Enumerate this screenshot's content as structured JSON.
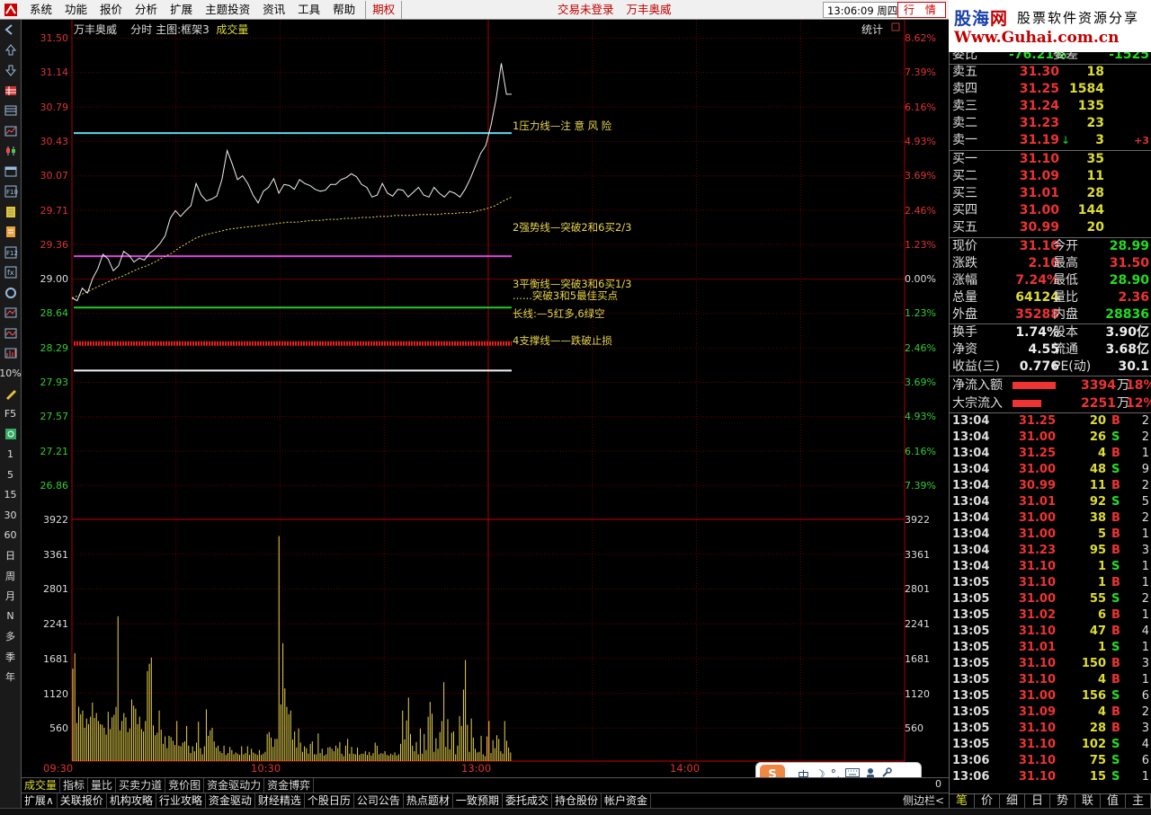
{
  "menu": {
    "items": [
      "系统",
      "功能",
      "报价",
      "分析",
      "扩展",
      "主题投资",
      "资讯",
      "工具",
      "帮助"
    ],
    "futures": "期权",
    "status_text": "交易未登录",
    "stock_name": "万丰奥威",
    "clock": "13:06:09 周四",
    "quote_btn": "行 情"
  },
  "brand": {
    "line1a": "股海",
    "line1b": "网",
    "line2": "股票软件资源分享",
    "line3": "Www.Guhai.com.cn"
  },
  "left_toolbar": {
    "icons": [
      "back-icon",
      "up-icon",
      "down-icon",
      "grid-icon",
      "table-icon",
      "chart-icon",
      "candle-icon",
      "window-icon",
      "f10-icon",
      "book-icon",
      "note-icon",
      "f12-icon",
      "formula-icon",
      "circle-icon",
      "trend-icon",
      "wave-icon",
      "bar-icon"
    ],
    "labels": [
      "10%",
      "F5",
      "1",
      "5",
      "15",
      "30",
      "60",
      "日",
      "周",
      "月",
      "N",
      "多",
      "季",
      "年"
    ]
  },
  "chart": {
    "header": {
      "name": "万丰奥威",
      "mode": "分时 主图:框架3",
      "vol": "成交量"
    },
    "stat_label": "统计",
    "price_labels": [
      "31.50",
      "31.14",
      "30.79",
      "30.43",
      "30.07",
      "29.71",
      "29.36",
      "29.00",
      "28.64",
      "28.29",
      "27.93",
      "27.57",
      "27.21",
      "26.86"
    ],
    "pct_labels": [
      "8.62%",
      "7.39%",
      "6.16%",
      "4.93%",
      "3.69%",
      "2.46%",
      "1.23%",
      "0.00%",
      "1.23%",
      "2.46%",
      "3.69%",
      "4.93%",
      "6.16%",
      "7.39%"
    ],
    "vol_labels": [
      "3922",
      "3361",
      "2801",
      "2241",
      "1681",
      "1120",
      "560"
    ],
    "time_labels": [
      "09:30",
      "10:30",
      "13:00",
      "14:00"
    ],
    "annotations": {
      "resist": "1压力线—注 意 风 险",
      "strong": "2强势线—突破2和6买2/3",
      "balance": "3平衡线—突破3和6买1/3",
      "best": "......突破3和5最佳买点",
      "long": "长线:—5红多,6绿空",
      "support": "4支撑线——跌破止损"
    },
    "levels": {
      "resist": 30.7,
      "strong": 29.43,
      "balance": 28.9,
      "long": 28.53,
      "support": 28.25
    },
    "colors": {
      "resist": "#5bd8ee",
      "strong": "#e040e0",
      "balance": "#22cc22",
      "long": "#e02020",
      "support": "#f4f4f4"
    },
    "price_series": [
      29.0,
      28.97,
      29.1,
      29.05,
      29.2,
      29.3,
      29.45,
      29.4,
      29.28,
      29.33,
      29.48,
      29.44,
      29.37,
      29.41,
      29.39,
      29.46,
      29.5,
      29.56,
      29.64,
      29.82,
      29.9,
      29.84,
      29.9,
      29.95,
      30.18,
      30.06,
      30.0,
      30.02,
      30.05,
      30.22,
      30.52,
      30.38,
      30.22,
      30.26,
      30.18,
      30.06,
      29.98,
      30.1,
      30.14,
      30.23,
      30.08,
      30.17,
      30.16,
      30.12,
      30.22,
      30.18,
      30.16,
      30.12,
      30.1,
      30.11,
      30.17,
      30.17,
      30.22,
      30.24,
      30.28,
      30.25,
      30.17,
      30.14,
      30.04,
      30.06,
      30.18,
      30.08,
      30.05,
      30.12,
      30.11,
      30.04,
      30.09,
      30.14,
      30.06,
      30.04,
      30.14,
      30.08,
      30.04,
      30.1,
      30.08,
      30.04,
      30.12,
      30.23,
      30.36,
      30.49,
      30.57,
      30.78,
      31.05,
      31.42,
      31.1,
      31.1
    ],
    "avg_series": [
      29.0,
      29.03,
      29.07,
      29.11,
      29.15,
      29.19,
      29.22,
      29.26,
      29.3,
      29.33,
      29.37,
      29.42,
      29.46,
      29.52,
      29.57,
      29.62,
      29.65,
      29.67,
      29.69,
      29.71,
      29.72,
      29.73,
      29.74,
      29.75,
      29.76,
      29.77,
      29.78,
      29.78,
      29.79,
      29.8,
      29.8,
      29.81,
      29.81,
      29.82,
      29.82,
      29.83,
      29.83,
      29.84,
      29.84,
      29.85,
      29.85,
      29.85,
      29.86,
      29.86,
      29.86,
      29.87,
      29.87,
      29.88,
      29.88,
      29.9,
      29.92,
      29.95,
      30.0,
      30.04
    ],
    "volume_series": [
      1500,
      1750,
      620,
      880,
      760,
      820,
      540,
      690,
      600,
      720,
      950,
      700,
      780,
      650,
      600,
      590,
      540,
      430,
      800,
      520,
      710,
      750,
      880,
      2350,
      500,
      650,
      780,
      710,
      470,
      530,
      1000,
      900,
      850,
      600,
      720,
      520,
      480,
      650,
      1460,
      1580,
      1680,
      580,
      420,
      460,
      820,
      510,
      280,
      400,
      210,
      410,
      390,
      330,
      260,
      650,
      250,
      240,
      300,
      320,
      570,
      250,
      130,
      240,
      160,
      300,
      640,
      210,
      110,
      240,
      840,
      410,
      500,
      540,
      320,
      220,
      250,
      160,
      130,
      250,
      100,
      130,
      230,
      180,
      110,
      140,
      120,
      100,
      240,
      110,
      130,
      240,
      100,
      200,
      140,
      120,
      100,
      180,
      100,
      120,
      150,
      440,
      470,
      380,
      230,
      360,
      360,
      3650,
      920,
      1910,
      1180,
      880,
      760,
      820,
      350,
      480,
      220,
      530,
      300,
      150,
      240,
      210,
      120,
      280,
      320,
      110,
      110,
      450,
      130,
      200,
      90,
      110,
      220,
      230,
      200,
      160,
      250,
      210,
      310,
      120,
      80,
      250,
      360,
      120,
      230,
      120,
      110,
      220,
      100,
      120,
      120,
      160,
      100,
      150,
      90,
      130,
      300,
      250,
      110,
      130,
      120,
      160,
      100,
      90,
      120,
      100,
      140,
      90,
      110,
      280,
      820,
      350,
      660,
      1030,
      440,
      250,
      160,
      310,
      110,
      530,
      120,
      440,
      180,
      720,
      960,
      770,
      150,
      370,
      200,
      470,
      650,
      1280,
      230,
      680,
      190,
      460,
      480,
      110,
      250,
      730,
      570,
      1160,
      1640,
      590,
      150,
      690,
      380,
      200,
      140,
      150,
      410,
      110,
      80,
      400,
      650,
      130,
      340,
      210,
      420,
      360,
      160,
      120,
      650,
      330,
      220,
      140
    ]
  },
  "tabs1": [
    "成交量",
    "指标",
    "量比",
    "买卖力道",
    "竞价图",
    "资金驱动力",
    "资金博弈"
  ],
  "tabs2": [
    "扩展∧",
    "关联报价",
    "机构攻略",
    "行业攻略",
    "资金驱动",
    "财经精选",
    "个股日历",
    "公司公告",
    "热点题材",
    "一致预期",
    "委托成交",
    "持仓股份",
    "帐户资金"
  ],
  "tabs2_side": "侧边栏<",
  "tabs_num": "0",
  "ime": {
    "logo": "S",
    "text": "中",
    "moon": "☽",
    "deg": "°,"
  },
  "right_panel": {
    "ratio": {
      "label": "委比",
      "value": "-76.21%",
      "diff_label": "委差",
      "diff": "-1525"
    },
    "asks": [
      {
        "label": "卖五",
        "price": "31.30",
        "vol": "18"
      },
      {
        "label": "卖四",
        "price": "31.25",
        "vol": "1584"
      },
      {
        "label": "卖三",
        "price": "31.24",
        "vol": "135"
      },
      {
        "label": "卖二",
        "price": "31.23",
        "vol": "23"
      },
      {
        "label": "卖一",
        "price": "31.19",
        "vol": "3",
        "extra": "+3"
      }
    ],
    "bids": [
      {
        "label": "买一",
        "price": "31.10",
        "vol": "35"
      },
      {
        "label": "买二",
        "price": "31.09",
        "vol": "11"
      },
      {
        "label": "买三",
        "price": "31.01",
        "vol": "28"
      },
      {
        "label": "买四",
        "price": "31.00",
        "vol": "144"
      },
      {
        "label": "买五",
        "price": "30.99",
        "vol": "20"
      }
    ],
    "stats": [
      {
        "l1": "现价",
        "v1": "31.10",
        "c1": "red",
        "l2": "今开",
        "v2": "28.99",
        "c2": "green"
      },
      {
        "l1": "涨跌",
        "v1": "2.10",
        "c1": "red",
        "l2": "最高",
        "v2": "31.50",
        "c2": "red"
      },
      {
        "l1": "涨幅",
        "v1": "7.24%",
        "c1": "red",
        "l2": "最低",
        "v2": "28.90",
        "c2": "green"
      },
      {
        "l1": "总量",
        "v1": "64124",
        "c1": "yellow",
        "l2": "量比",
        "v2": "2.36",
        "c2": "red"
      },
      {
        "l1": "外盘",
        "v1": "35288",
        "c1": "red",
        "l2": "内盘",
        "v2": "28836",
        "c2": "green"
      }
    ],
    "stats2": [
      {
        "l1": "换手",
        "v1": "1.74%",
        "c1": "white",
        "l2": "股本",
        "v2": "3.90亿",
        "c2": "white"
      },
      {
        "l1": "净资",
        "v1": "4.55",
        "c1": "white",
        "l2": "流通",
        "v2": "3.68亿",
        "c2": "white"
      },
      {
        "l1": "收益(三)",
        "v1": "0.776",
        "c1": "white",
        "l2": "PE(动)",
        "v2": "30.1",
        "c2": "white"
      }
    ],
    "flows": [
      {
        "label": "净流入额",
        "value": "3394",
        "unit": "万",
        "pct": "18%",
        "fill": 0.18
      },
      {
        "label": "大宗流入",
        "value": "2251",
        "unit": "万",
        "pct": "12%",
        "fill": 0.12
      }
    ],
    "ticks": [
      {
        "t": "13:04",
        "p": "31.25",
        "v": "20",
        "bs": "B",
        "n": "2"
      },
      {
        "t": "13:04",
        "p": "31.00",
        "v": "26",
        "bs": "S",
        "n": "2"
      },
      {
        "t": "13:04",
        "p": "31.25",
        "v": "4",
        "bs": "B",
        "n": "1"
      },
      {
        "t": "13:04",
        "p": "31.00",
        "v": "48",
        "bs": "S",
        "n": "9"
      },
      {
        "t": "13:04",
        "p": "30.99",
        "v": "11",
        "bs": "B",
        "n": "2"
      },
      {
        "t": "13:04",
        "p": "31.01",
        "v": "92",
        "bs": "S",
        "n": "5"
      },
      {
        "t": "13:04",
        "p": "31.00",
        "v": "38",
        "bs": "B",
        "n": "2"
      },
      {
        "t": "13:04",
        "p": "31.00",
        "v": "5",
        "bs": "B",
        "n": "1"
      },
      {
        "t": "13:04",
        "p": "31.23",
        "v": "95",
        "bs": "B",
        "n": "3"
      },
      {
        "t": "13:04",
        "p": "31.10",
        "v": "1",
        "bs": "S",
        "n": "1"
      },
      {
        "t": "13:05",
        "p": "31.10",
        "v": "1",
        "bs": "B",
        "n": "1"
      },
      {
        "t": "13:05",
        "p": "31.00",
        "v": "55",
        "bs": "S",
        "n": "2"
      },
      {
        "t": "13:05",
        "p": "31.02",
        "v": "6",
        "bs": "B",
        "n": "1"
      },
      {
        "t": "13:05",
        "p": "31.10",
        "v": "47",
        "bs": "B",
        "n": "4"
      },
      {
        "t": "13:05",
        "p": "31.01",
        "v": "1",
        "bs": "S",
        "n": "1"
      },
      {
        "t": "13:05",
        "p": "31.10",
        "v": "150",
        "bs": "B",
        "n": "3"
      },
      {
        "t": "13:05",
        "p": "31.10",
        "v": "4",
        "bs": "B",
        "n": "1"
      },
      {
        "t": "13:05",
        "p": "31.00",
        "v": "156",
        "bs": "S",
        "n": "6"
      },
      {
        "t": "13:05",
        "p": "31.09",
        "v": "4",
        "bs": "B",
        "n": "2"
      },
      {
        "t": "13:05",
        "p": "31.10",
        "v": "28",
        "bs": "B",
        "n": "3"
      },
      {
        "t": "13:05",
        "p": "31.10",
        "v": "102",
        "bs": "S",
        "n": "4"
      },
      {
        "t": "13:06",
        "p": "31.10",
        "v": "75",
        "bs": "S",
        "n": "6"
      },
      {
        "t": "13:06",
        "p": "31.10",
        "v": "15",
        "bs": "S",
        "n": "1"
      }
    ],
    "bottom_tabs": [
      "笔",
      "价",
      "细",
      "日",
      "势",
      "联",
      "值",
      "主"
    ]
  }
}
